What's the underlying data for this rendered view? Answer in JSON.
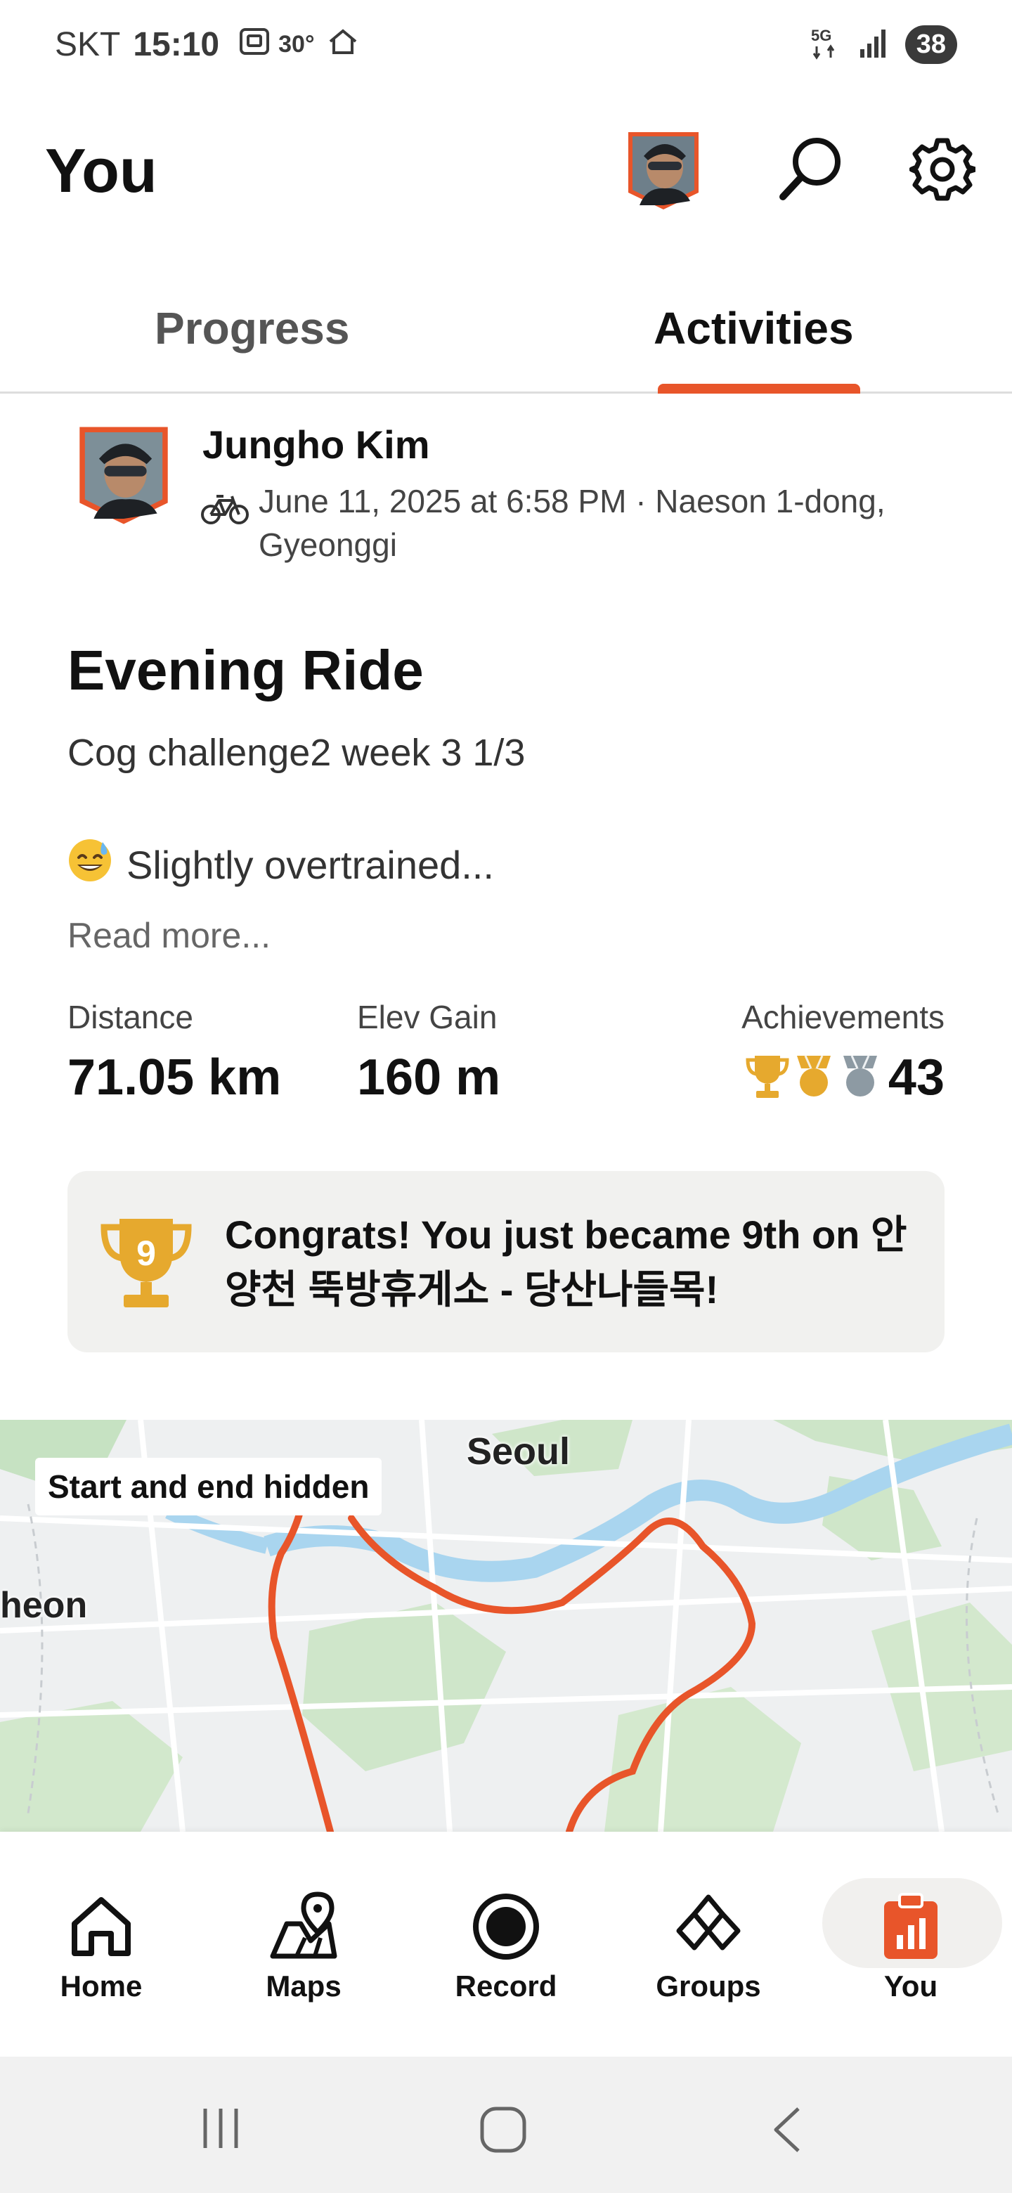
{
  "status_bar": {
    "carrier": "SKT",
    "time": "15:10",
    "temperature": "30°",
    "network": "5G",
    "battery": "38"
  },
  "header": {
    "title": "You"
  },
  "tabs": [
    {
      "label": "Progress",
      "selected": false
    },
    {
      "label": "Activities",
      "selected": true
    }
  ],
  "activity": {
    "athlete_name": "Jungho Kim",
    "meta": "June 11, 2025 at 6:58 PM · Naeson 1-dong, Gyeonggi",
    "title": "Evening Ride",
    "description": "Cog challenge2 week 3 1/3",
    "mood_text": "Slightly overtrained...",
    "read_more": "Read more...",
    "stats": {
      "distance_label": "Distance",
      "distance_value": "71.05 km",
      "elev_label": "Elev Gain",
      "elev_value": "160 m",
      "achievements_label": "Achievements",
      "achievements_count": "43"
    },
    "congrats": {
      "rank": "9",
      "text": "Congrats! You just became 9th on 안양천 뚝방휴게소 - 당산나들목!"
    }
  },
  "map": {
    "badge": "Start and end hidden",
    "label_top": "Seoul",
    "label_left": "heon"
  },
  "bottom_nav": [
    {
      "label": "Home",
      "icon": "home-icon"
    },
    {
      "label": "Maps",
      "icon": "maps-icon"
    },
    {
      "label": "Record",
      "icon": "record-icon"
    },
    {
      "label": "Groups",
      "icon": "groups-icon"
    },
    {
      "label": "You",
      "icon": "you-icon",
      "selected": true
    }
  ],
  "colors": {
    "accent": "#e8552a",
    "gold": "#e6a92e",
    "route": "#e8552a"
  }
}
